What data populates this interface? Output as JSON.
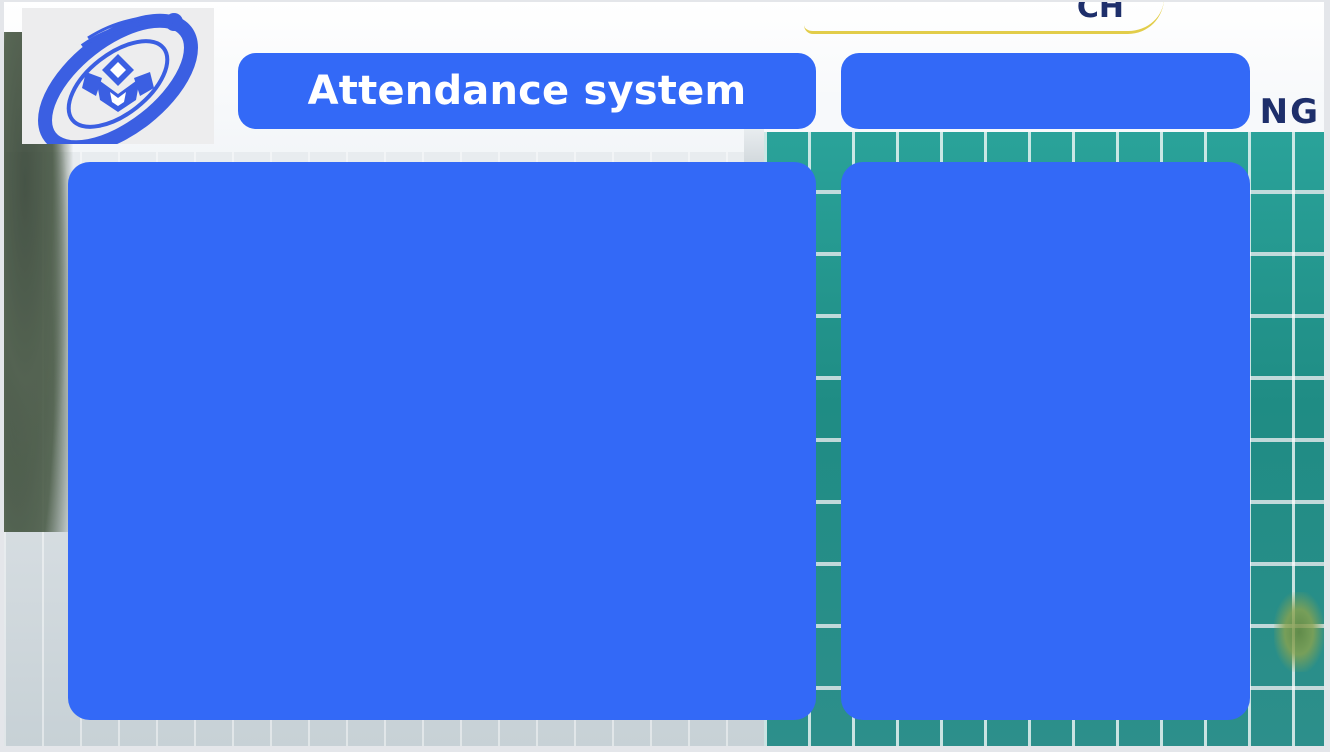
{
  "header": {
    "title": "Attendance system",
    "side_title": ""
  },
  "background": {
    "sign_text": "NG",
    "script_text": "CH"
  },
  "logo": {
    "icon": "university-logo-icon"
  },
  "colors": {
    "accent": "#3369f7",
    "logo_blue": "#3b5fe2",
    "text_on_accent": "#ffffff"
  }
}
